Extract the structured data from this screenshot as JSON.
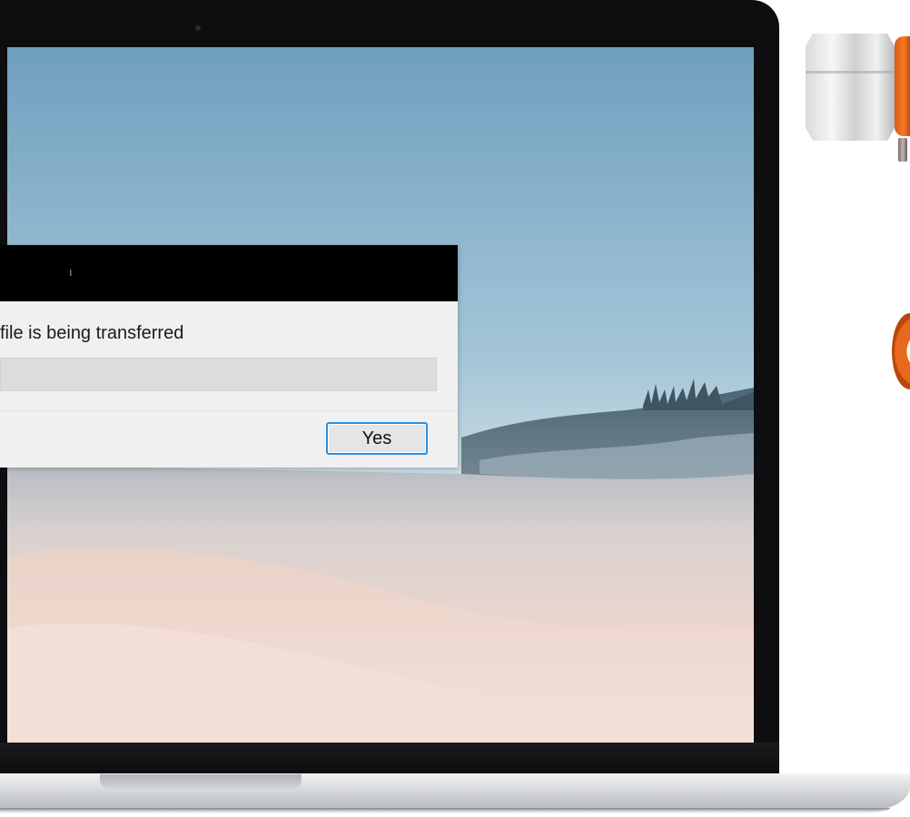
{
  "dialog": {
    "title": "ı",
    "message": "file is being transferred",
    "progress": 0.0,
    "yes_label": "Yes"
  },
  "colors": {
    "titlebar": "#000000",
    "dialog_background": "#f0f0f0",
    "progress_track": "#dcdcdc",
    "button_focus_border": "#2d8ee0",
    "laptop_bezel": "#0e0e10",
    "product_orange": "#f57a26"
  },
  "icons": {
    "camera": "webcam-dot"
  }
}
